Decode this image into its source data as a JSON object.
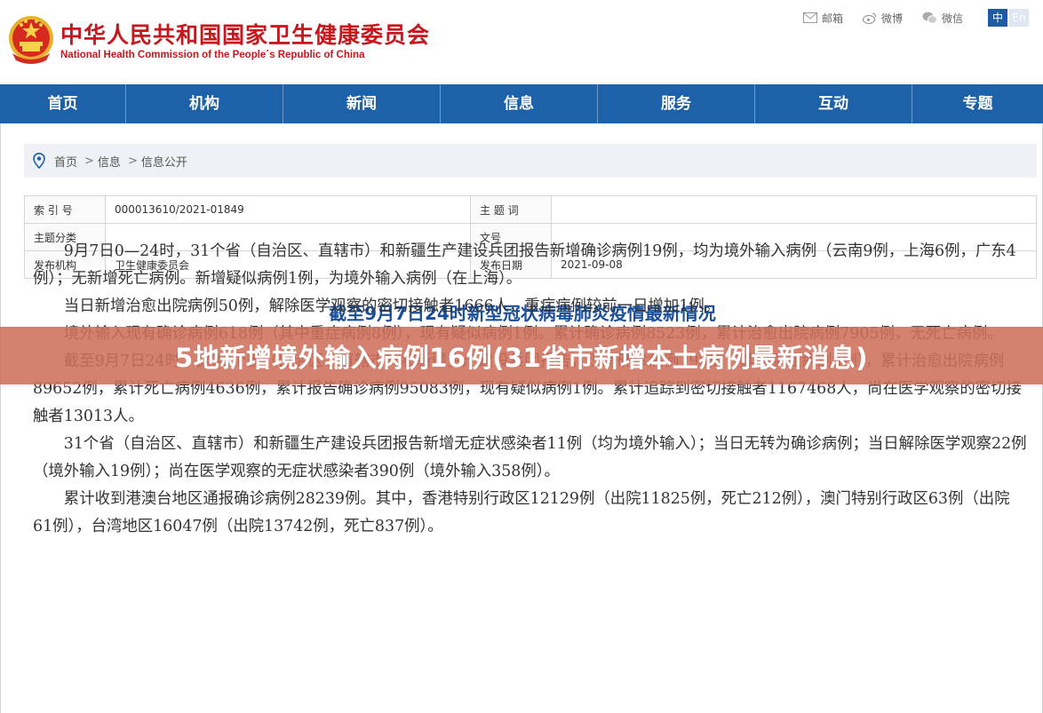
{
  "header": {
    "org_cn": "中华人民共和国国家卫生健康委员会",
    "org_en": "National Health Commission of the People´s Republic of China",
    "links": [
      {
        "label": "邮箱",
        "icon": "mail-icon"
      },
      {
        "label": "微博",
        "icon": "weibo-icon"
      },
      {
        "label": "微信",
        "icon": "wechat-icon"
      }
    ],
    "lang_zh": "中",
    "lang_en": "En"
  },
  "nav": {
    "items": [
      "首页",
      "机构",
      "新闻",
      "信息",
      "服务",
      "互动",
      "专题"
    ]
  },
  "breadcrumb": {
    "items": [
      "首页",
      "信息",
      "信息公开"
    ],
    "sep": ">"
  },
  "meta": {
    "index_label": "索 引 号",
    "index_value": "000013610/2021-01849",
    "topic_word_label": "主 题 词",
    "topic_word_value": "",
    "topic_class_label": "主题分类",
    "topic_class_value": "",
    "doc_no_label": "文号",
    "doc_no_value": "",
    "publisher_label": "发布机构",
    "publisher_value": "卫生健康委员会",
    "date_label": "发布日期",
    "date_value": "2021-09-08"
  },
  "article": {
    "title": "截至9月7日24时新型冠状病毒肺炎疫情最新情况",
    "paragraphs": [
      "9月7日0—24时，31个省（自治区、直辖市）和新疆生产建设兵团报告新增确诊病例19例，均为境外输入病例（云南9例，上海6例，广东4例）；无新增死亡病例。新增疑似病例1例，为境外输入病例（在上海）。",
      "当日新增治愈出院病例50例，解除医学观察的密切接触者1666人，重症病例较前一日增加1例。",
      "境外输入现有确诊病例618例（其中重症病例8例），现有疑似病例1例。累计确诊病例8523例，累计治愈出院病例7905例，无死亡病例。",
      "截至9月7日24时，据31个省（自治区、直辖市）和新疆生产建设兵团报告，现有确诊病例795例（其中重症病例8例），累计治愈出院病例89652例，累计死亡病例4636例，累计报告确诊病例95083例，现有疑似病例1例。累计追踪到密切接触者1167468人，尚在医学观察的密切接触者13013人。",
      "31个省（自治区、直辖市）和新疆生产建设兵团报告新增无症状感染者11例（均为境外输入）；当日无转为确诊病例；当日解除医学观察22例（境外输入19例）；尚在医学观察的无症状感染者390例（境外输入358例）。",
      "累计收到港澳台地区通报确诊病例28239例。其中，香港特别行政区12129例（出院11825例，死亡212例），澳门特别行政区63例（出院61例），台湾地区16047例（出院13742例，死亡837例）。"
    ]
  },
  "banner": {
    "text": "5地新增境外输入病例16例(31省市新增本土病例最新消息)"
  },
  "colors": {
    "brand_red": "#c8161d",
    "nav_blue": "#1d61a8",
    "title_blue": "#1b4f9a",
    "banner": "#ce705c"
  }
}
